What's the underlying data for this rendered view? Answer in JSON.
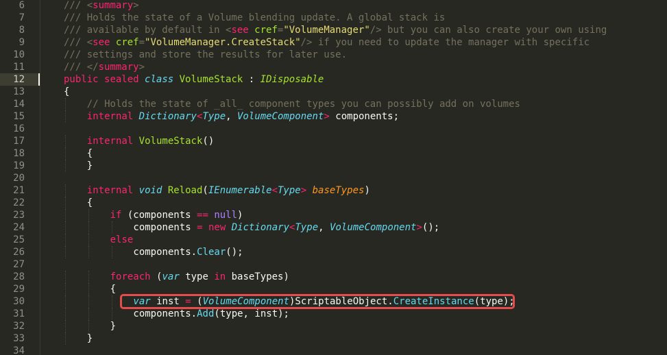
{
  "editor": {
    "current_line": 12,
    "colors": {
      "background": "#272822",
      "comment": "#75715e",
      "keyword": "#f92672",
      "type": "#66d9ef",
      "function": "#a6e22e",
      "parameter": "#fd971f",
      "string": "#e6db74",
      "highlight_box": "#e74c4c"
    },
    "lines": [
      {
        "n": "6",
        "indent": 1,
        "tokens": [
          {
            "c": "t-comment",
            "t": "/// <"
          },
          {
            "c": "t-tag",
            "t": "summary"
          },
          {
            "c": "t-comment",
            "t": ">"
          }
        ]
      },
      {
        "n": "7",
        "indent": 1,
        "tokens": [
          {
            "c": "t-comment",
            "t": "/// Holds the state of a Volume blending update. A global stack is"
          }
        ]
      },
      {
        "n": "8",
        "indent": 1,
        "tokens": [
          {
            "c": "t-comment",
            "t": "/// available by default in <"
          },
          {
            "c": "t-tag",
            "t": "see"
          },
          {
            "c": "t-comment",
            "t": " "
          },
          {
            "c": "t-attr",
            "t": "cref"
          },
          {
            "c": "t-comment",
            "t": "="
          },
          {
            "c": "t-str",
            "t": "\"VolumeManager\""
          },
          {
            "c": "t-comment",
            "t": "/> but you can also create your own using"
          }
        ]
      },
      {
        "n": "9",
        "indent": 1,
        "tokens": [
          {
            "c": "t-comment",
            "t": "/// <"
          },
          {
            "c": "t-tag",
            "t": "see"
          },
          {
            "c": "t-comment",
            "t": " "
          },
          {
            "c": "t-attr",
            "t": "cref"
          },
          {
            "c": "t-comment",
            "t": "="
          },
          {
            "c": "t-str",
            "t": "\"VolumeManager.CreateStack\""
          },
          {
            "c": "t-comment",
            "t": "/> if you need to update the manager with specific"
          }
        ]
      },
      {
        "n": "10",
        "indent": 1,
        "tokens": [
          {
            "c": "t-comment",
            "t": "/// settings and store the results for later use."
          }
        ]
      },
      {
        "n": "11",
        "indent": 1,
        "tokens": [
          {
            "c": "t-comment",
            "t": "/// </"
          },
          {
            "c": "t-tag",
            "t": "summary"
          },
          {
            "c": "t-comment",
            "t": ">"
          }
        ]
      },
      {
        "n": "12",
        "indent": 1,
        "tokens": [
          {
            "c": "t-keyword",
            "t": "public"
          },
          {
            "c": "t-plain",
            "t": " "
          },
          {
            "c": "t-keyword",
            "t": "sealed"
          },
          {
            "c": "t-plain",
            "t": " "
          },
          {
            "c": "t-storage",
            "t": "class"
          },
          {
            "c": "t-plain",
            "t": " "
          },
          {
            "c": "t-class",
            "t": "VolumeStack"
          },
          {
            "c": "t-plain",
            "t": " : "
          },
          {
            "c": "t-inherit",
            "t": "IDisposable"
          }
        ]
      },
      {
        "n": "13",
        "indent": 1,
        "tokens": [
          {
            "c": "t-plain",
            "t": "{"
          }
        ]
      },
      {
        "n": "14",
        "indent": 2,
        "tokens": [
          {
            "c": "t-comment",
            "t": "// Holds the state of _all_ component types you can possibly add on volumes"
          }
        ]
      },
      {
        "n": "15",
        "indent": 2,
        "tokens": [
          {
            "c": "t-keyword",
            "t": "internal"
          },
          {
            "c": "t-plain",
            "t": " "
          },
          {
            "c": "t-type",
            "t": "Dictionary"
          },
          {
            "c": "t-op",
            "t": "<"
          },
          {
            "c": "t-type",
            "t": "Type"
          },
          {
            "c": "t-plain",
            "t": ", "
          },
          {
            "c": "t-type",
            "t": "VolumeComponent"
          },
          {
            "c": "t-op",
            "t": ">"
          },
          {
            "c": "t-plain",
            "t": " components;"
          }
        ]
      },
      {
        "n": "16",
        "indent": 0,
        "tokens": []
      },
      {
        "n": "17",
        "indent": 2,
        "tokens": [
          {
            "c": "t-keyword",
            "t": "internal"
          },
          {
            "c": "t-plain",
            "t": " "
          },
          {
            "c": "t-func",
            "t": "VolumeStack"
          },
          {
            "c": "t-plain",
            "t": "()"
          }
        ]
      },
      {
        "n": "18",
        "indent": 2,
        "tokens": [
          {
            "c": "t-plain",
            "t": "{"
          }
        ]
      },
      {
        "n": "19",
        "indent": 2,
        "tokens": [
          {
            "c": "t-plain",
            "t": "}"
          }
        ]
      },
      {
        "n": "20",
        "indent": 0,
        "tokens": []
      },
      {
        "n": "21",
        "indent": 2,
        "tokens": [
          {
            "c": "t-keyword",
            "t": "internal"
          },
          {
            "c": "t-plain",
            "t": " "
          },
          {
            "c": "t-storage",
            "t": "void"
          },
          {
            "c": "t-plain",
            "t": " "
          },
          {
            "c": "t-func",
            "t": "Reload"
          },
          {
            "c": "t-plain",
            "t": "("
          },
          {
            "c": "t-type",
            "t": "IEnumerable"
          },
          {
            "c": "t-op",
            "t": "<"
          },
          {
            "c": "t-type",
            "t": "Type"
          },
          {
            "c": "t-op",
            "t": ">"
          },
          {
            "c": "t-plain",
            "t": " "
          },
          {
            "c": "t-param",
            "t": "baseTypes"
          },
          {
            "c": "t-plain",
            "t": ")"
          }
        ]
      },
      {
        "n": "22",
        "indent": 2,
        "tokens": [
          {
            "c": "t-plain",
            "t": "{"
          }
        ]
      },
      {
        "n": "23",
        "indent": 3,
        "tokens": [
          {
            "c": "t-keyword",
            "t": "if"
          },
          {
            "c": "t-plain",
            "t": " (components "
          },
          {
            "c": "t-op",
            "t": "=="
          },
          {
            "c": "t-plain",
            "t": " "
          },
          {
            "c": "t-const",
            "t": "null"
          },
          {
            "c": "t-plain",
            "t": ")"
          }
        ]
      },
      {
        "n": "24",
        "indent": 4,
        "tokens": [
          {
            "c": "t-plain",
            "t": "components "
          },
          {
            "c": "t-op",
            "t": "="
          },
          {
            "c": "t-plain",
            "t": " "
          },
          {
            "c": "t-keyword",
            "t": "new"
          },
          {
            "c": "t-plain",
            "t": " "
          },
          {
            "c": "t-type",
            "t": "Dictionary"
          },
          {
            "c": "t-op",
            "t": "<"
          },
          {
            "c": "t-type",
            "t": "Type"
          },
          {
            "c": "t-plain",
            "t": ", "
          },
          {
            "c": "t-type",
            "t": "VolumeComponent"
          },
          {
            "c": "t-op",
            "t": ">"
          },
          {
            "c": "t-plain",
            "t": "();"
          }
        ]
      },
      {
        "n": "25",
        "indent": 3,
        "tokens": [
          {
            "c": "t-keyword",
            "t": "else"
          }
        ]
      },
      {
        "n": "26",
        "indent": 4,
        "tokens": [
          {
            "c": "t-plain",
            "t": "components."
          },
          {
            "c": "t-call",
            "t": "Clear"
          },
          {
            "c": "t-plain",
            "t": "();"
          }
        ]
      },
      {
        "n": "27",
        "indent": 0,
        "tokens": []
      },
      {
        "n": "28",
        "indent": 3,
        "tokens": [
          {
            "c": "t-keyword",
            "t": "foreach"
          },
          {
            "c": "t-plain",
            "t": " ("
          },
          {
            "c": "t-storage",
            "t": "var"
          },
          {
            "c": "t-plain",
            "t": " type "
          },
          {
            "c": "t-keyword",
            "t": "in"
          },
          {
            "c": "t-plain",
            "t": " baseTypes)"
          }
        ]
      },
      {
        "n": "29",
        "indent": 3,
        "tokens": [
          {
            "c": "t-plain",
            "t": "{"
          }
        ]
      },
      {
        "n": "30",
        "indent": 4,
        "tokens": [
          {
            "c": "t-storage",
            "t": "var"
          },
          {
            "c": "t-plain",
            "t": " inst "
          },
          {
            "c": "t-op",
            "t": "="
          },
          {
            "c": "t-plain",
            "t": " ("
          },
          {
            "c": "t-type",
            "t": "VolumeComponent"
          },
          {
            "c": "t-plain",
            "t": ")ScriptableObject."
          },
          {
            "c": "t-call",
            "t": "CreateInstance"
          },
          {
            "c": "t-plain",
            "t": "(type);"
          }
        ]
      },
      {
        "n": "31",
        "indent": 4,
        "tokens": [
          {
            "c": "t-plain",
            "t": "components."
          },
          {
            "c": "t-call",
            "t": "Add"
          },
          {
            "c": "t-plain",
            "t": "(type, inst);"
          }
        ]
      },
      {
        "n": "32",
        "indent": 3,
        "tokens": [
          {
            "c": "t-plain",
            "t": "}"
          }
        ]
      },
      {
        "n": "33",
        "indent": 2,
        "tokens": [
          {
            "c": "t-plain",
            "t": "}"
          }
        ]
      },
      {
        "n": "34",
        "indent": 0,
        "tokens": []
      }
    ]
  }
}
